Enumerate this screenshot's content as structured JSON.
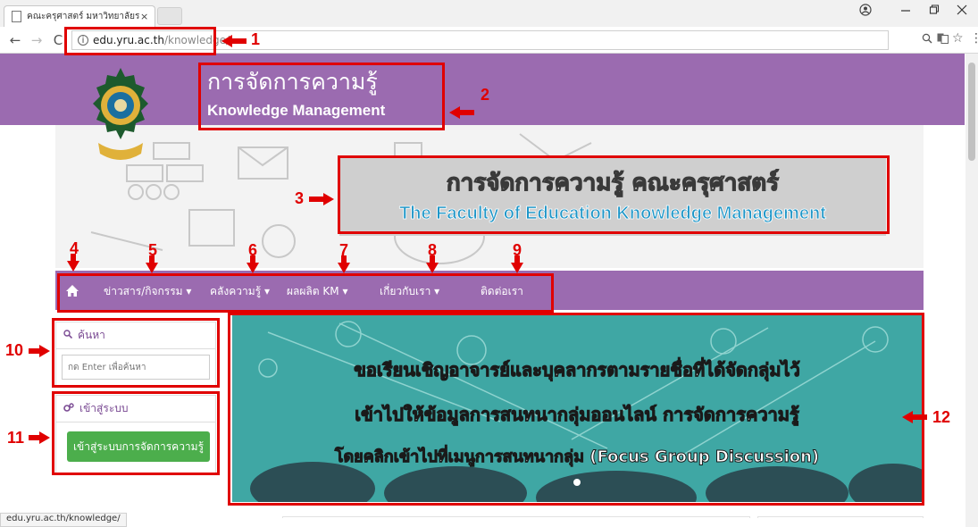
{
  "browser": {
    "tab_title": "คณะครุศาสตร์ มหาวิทยาลัยร",
    "tab_close": "×",
    "url_host": "edu.yru.ac.th",
    "url_path": "/knowledge/",
    "back": "←",
    "forward": "→",
    "reload": "C",
    "status_url": "edu.yru.ac.th/knowledge/"
  },
  "header": {
    "title": "การจัดการความรู้",
    "subtitle": "Knowledge Management"
  },
  "banner": {
    "title_th": "การจัดการความรู้  คณะครุศาสตร์",
    "title_en": "The Faculty of Education  Knowledge  Management"
  },
  "menu": {
    "items": [
      {
        "label": "ข่าวสาร/กิจกรรม"
      },
      {
        "label": "คลังความรู้"
      },
      {
        "label": "ผลผลิต KM"
      },
      {
        "label": "เกี่ยวกับเรา"
      },
      {
        "label": "ติดต่อเรา"
      }
    ]
  },
  "sidebar": {
    "search_title": "ค้นหา",
    "search_placeholder": "กด Enter เพื่อค้นหา",
    "login_title": "เข้าสู่ระบบ",
    "login_button": "เข้าสู่ระบบการจัดการความรู้"
  },
  "slide": {
    "lines": [
      "ขอเรียนเชิญอาจารย์และบุคลากรตามรายชื่อที่ได้จัดกลุ่มไว้",
      "เข้าไปให้ข้อมูลการสนทนากลุ่มออนไลน์ การจัดการความรู้",
      "โดยคลิกเข้าไปที่เมนูการสนทนากลุ่ม (Focus Group Discussion)"
    ]
  },
  "annotations": {
    "color": "#e00000",
    "numbers": [
      "1",
      "2",
      "3",
      "4",
      "5",
      "6",
      "7",
      "8",
      "9",
      "10",
      "11",
      "12"
    ]
  },
  "colors": {
    "purple": "#9b6bb0",
    "green_button": "#4cae4c",
    "slide_teal": "#3fa7a4"
  }
}
